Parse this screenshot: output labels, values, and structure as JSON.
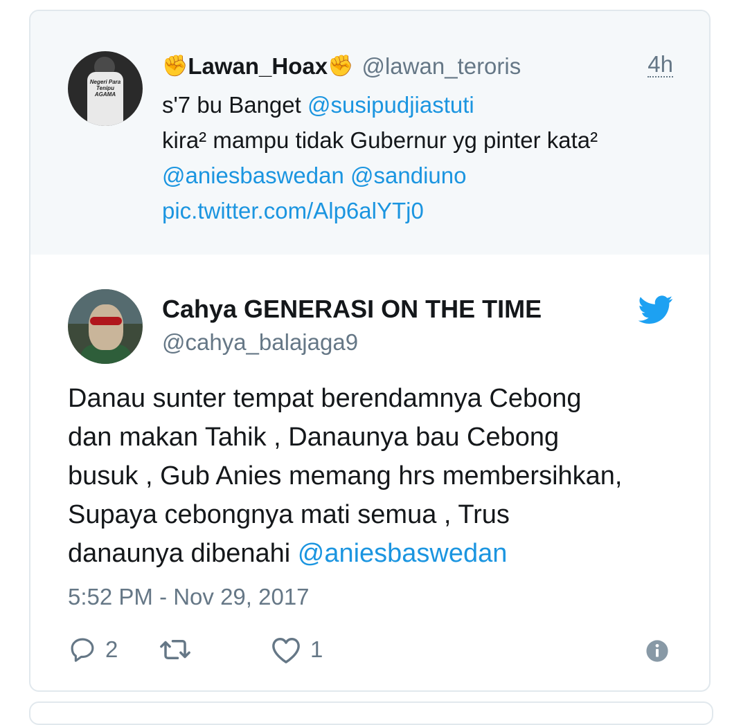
{
  "parent_tweet": {
    "emoji_left": "✊",
    "display_name": "Lawan_Hoax",
    "emoji_right": "✊",
    "handle": "@lawan_teroris",
    "time": "4h",
    "avatar_shirt_text": "Negeri Para Tenipu AGAMA",
    "lines": [
      {
        "text": "s'7 bu Banget ",
        "mention": "@susipudjiastuti"
      },
      {
        "text": "kira² mampu tidak Gubernur yg pinter kata²",
        "mention": ""
      },
      {
        "text": "",
        "mention": "@aniesbaswedan @sandiuno"
      },
      {
        "text": "",
        "mention": "pic.twitter.com/Alp6alYTj0"
      }
    ]
  },
  "main_tweet": {
    "display_name": "Cahya GENERASI ON THE TIME",
    "handle": "@cahya_balajaga9",
    "text_lines": [
      "Danau sunter tempat berendamnya Cebong",
      "dan makan Tahik , Danaunya bau Cebong",
      "busuk , Gub Anies memang hrs membersihkan,",
      "Supaya cebongnya mati semua , Trus"
    ],
    "last_line_text": "danaunya dibenahi ",
    "last_line_mention": "@aniesbaswedan",
    "date": "5:52 PM - Nov 29, 2017",
    "reply_count": "2",
    "retweet_count": "",
    "like_count": "1",
    "icons": {
      "brand": "twitter-bird-icon",
      "reply": "reply-icon",
      "retweet": "retweet-icon",
      "like": "heart-icon",
      "info": "info-icon"
    }
  },
  "colors": {
    "link": "#1b95e0",
    "secondary_text": "#657786",
    "primary_text": "#14171a",
    "parent_background": "#f5f8fa",
    "border": "#e1e8ed"
  }
}
